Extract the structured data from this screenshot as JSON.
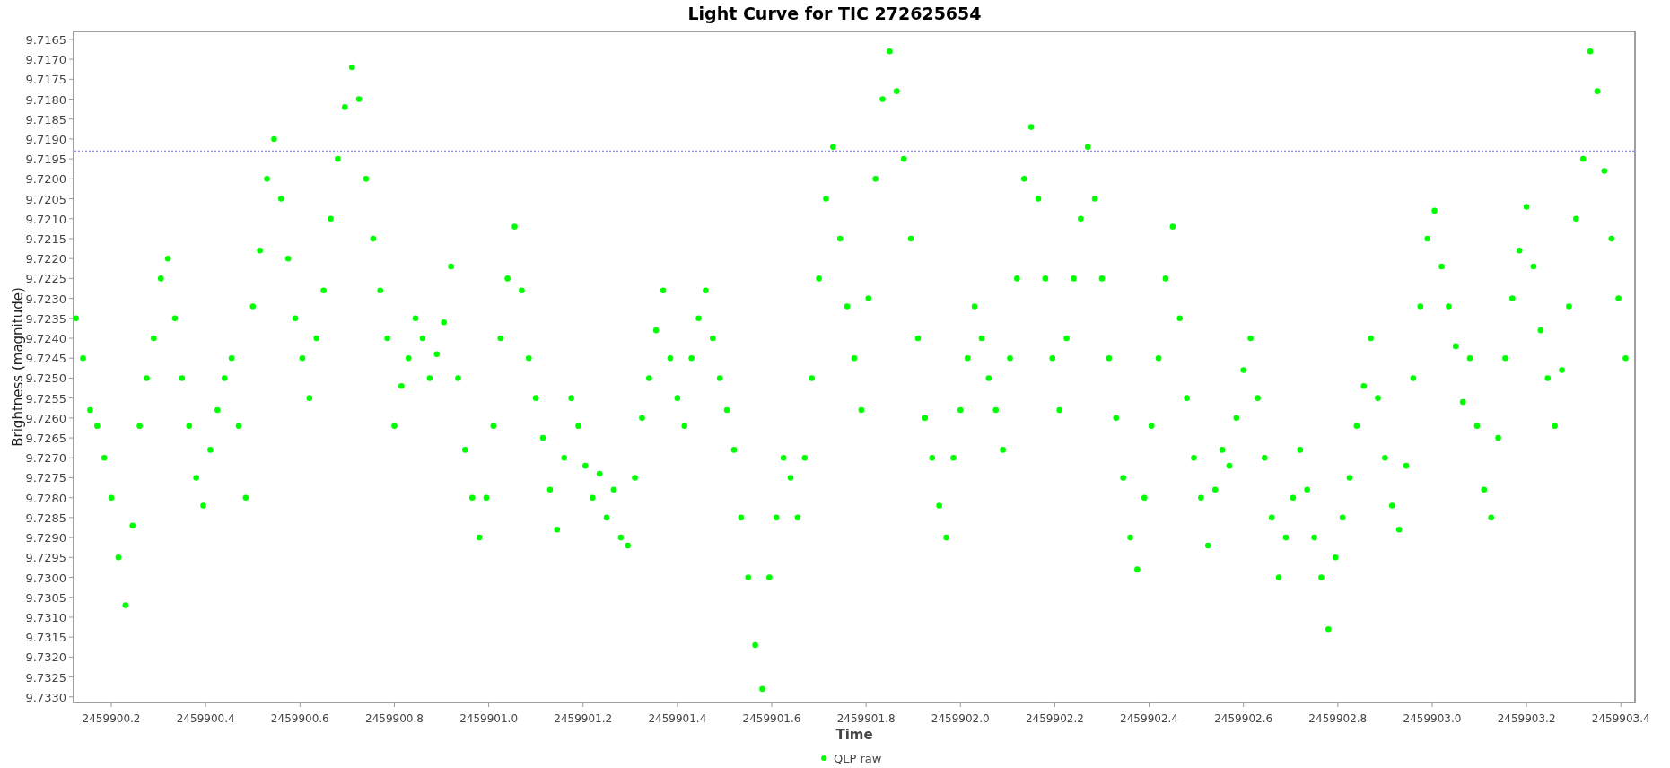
{
  "chart": {
    "chart_data": {
      "type": "scatter",
      "title": "Light Curve for TIC 272625654",
      "xlabel": "Time",
      "ylabel": "Brightness (magnitude)",
      "xlim": [
        2459900.12,
        2459903.43
      ],
      "ylim": [
        9.73314,
        9.7163
      ],
      "xticks": [
        {
          "value": 2459900.2,
          "label": "2459900.2"
        },
        {
          "value": 2459900.4,
          "label": "2459900.4"
        },
        {
          "value": 2459900.6,
          "label": "2459900.6"
        },
        {
          "value": 2459900.8,
          "label": "2459900.8"
        },
        {
          "value": 2459901.0,
          "label": "2459901.0"
        },
        {
          "value": 2459901.2,
          "label": "2459901.2"
        },
        {
          "value": 2459901.4,
          "label": "2459901.4"
        },
        {
          "value": 2459901.6,
          "label": "2459901.6"
        },
        {
          "value": 2459901.8,
          "label": "2459901.8"
        },
        {
          "value": 2459902.0,
          "label": "2459902.0"
        },
        {
          "value": 2459902.2,
          "label": "2459902.2"
        },
        {
          "value": 2459902.4,
          "label": "2459902.4"
        },
        {
          "value": 2459902.6,
          "label": "2459902.6"
        },
        {
          "value": 2459902.8,
          "label": "2459902.8"
        },
        {
          "value": 2459903.0,
          "label": "2459903.0"
        },
        {
          "value": 2459903.2,
          "label": "2459903.2"
        },
        {
          "value": 2459903.4,
          "label": "2459903.4"
        }
      ],
      "yticks": [
        {
          "value": 9.7165,
          "label": "9.7165"
        },
        {
          "value": 9.717,
          "label": "9.7170"
        },
        {
          "value": 9.7175,
          "label": "9.7175"
        },
        {
          "value": 9.718,
          "label": "9.7180"
        },
        {
          "value": 9.7185,
          "label": "9.7185"
        },
        {
          "value": 9.719,
          "label": "9.7190"
        },
        {
          "value": 9.7195,
          "label": "9.7195"
        },
        {
          "value": 9.72,
          "label": "9.7200"
        },
        {
          "value": 9.7205,
          "label": "9.7205"
        },
        {
          "value": 9.721,
          "label": "9.7210"
        },
        {
          "value": 9.7215,
          "label": "9.7215"
        },
        {
          "value": 9.722,
          "label": "9.7220"
        },
        {
          "value": 9.7225,
          "label": "9.7225"
        },
        {
          "value": 9.723,
          "label": "9.7230"
        },
        {
          "value": 9.7235,
          "label": "9.7235"
        },
        {
          "value": 9.724,
          "label": "9.7240"
        },
        {
          "value": 9.7245,
          "label": "9.7245"
        },
        {
          "value": 9.725,
          "label": "9.7250"
        },
        {
          "value": 9.7255,
          "label": "9.7255"
        },
        {
          "value": 9.726,
          "label": "9.7260"
        },
        {
          "value": 9.7265,
          "label": "9.7265"
        },
        {
          "value": 9.727,
          "label": "9.7270"
        },
        {
          "value": 9.7275,
          "label": "9.7275"
        },
        {
          "value": 9.728,
          "label": "9.7280"
        },
        {
          "value": 9.7285,
          "label": "9.7285"
        },
        {
          "value": 9.729,
          "label": "9.7290"
        },
        {
          "value": 9.7295,
          "label": "9.7295"
        },
        {
          "value": 9.73,
          "label": "9.7300"
        },
        {
          "value": 9.7305,
          "label": "9.7305"
        },
        {
          "value": 9.731,
          "label": "9.7310"
        },
        {
          "value": 9.7315,
          "label": "9.7315"
        },
        {
          "value": 9.732,
          "label": "9.7320"
        },
        {
          "value": 9.7325,
          "label": "9.7325"
        },
        {
          "value": 9.733,
          "label": "9.7330"
        }
      ],
      "ref_lines": [
        {
          "axis": "y",
          "value": 9.7193
        }
      ],
      "x": [
        2459900.125,
        2459900.14,
        2459900.155,
        2459900.17,
        2459900.185,
        2459900.2,
        2459900.215,
        2459900.23,
        2459900.245,
        2459900.26,
        2459900.275,
        2459900.29,
        2459900.305,
        2459900.32,
        2459900.335,
        2459900.35,
        2459900.365,
        2459900.38,
        2459900.395,
        2459900.41,
        2459900.425,
        2459900.44,
        2459900.455,
        2459900.47,
        2459900.485,
        2459900.5,
        2459900.515,
        2459900.53,
        2459900.545,
        2459900.56,
        2459900.575,
        2459900.59,
        2459900.605,
        2459900.62,
        2459900.635,
        2459900.65,
        2459900.665,
        2459900.68,
        2459900.695,
        2459900.71,
        2459900.725,
        2459900.74,
        2459900.755,
        2459900.77,
        2459900.785,
        2459900.8,
        2459900.815,
        2459900.83,
        2459900.845,
        2459900.86,
        2459900.875,
        2459900.89,
        2459900.905,
        2459900.92,
        2459900.935,
        2459900.95,
        2459900.965,
        2459900.98,
        2459900.995,
        2459901.01,
        2459901.025,
        2459901.04,
        2459901.055,
        2459901.07,
        2459901.085,
        2459901.1,
        2459901.115,
        2459901.13,
        2459901.145,
        2459901.16,
        2459901.175,
        2459901.19,
        2459901.205,
        2459901.22,
        2459901.235,
        2459901.25,
        2459901.265,
        2459901.28,
        2459901.295,
        2459901.31,
        2459901.325,
        2459901.34,
        2459901.355,
        2459901.37,
        2459901.385,
        2459901.4,
        2459901.415,
        2459901.43,
        2459901.445,
        2459901.46,
        2459901.475,
        2459901.49,
        2459901.505,
        2459901.52,
        2459901.535,
        2459901.55,
        2459901.565,
        2459901.58,
        2459901.595,
        2459901.61,
        2459901.625,
        2459901.64,
        2459901.655,
        2459901.67,
        2459901.685,
        2459901.7,
        2459901.715,
        2459901.73,
        2459901.745,
        2459901.76,
        2459901.775,
        2459901.79,
        2459901.805,
        2459901.82,
        2459901.835,
        2459901.85,
        2459901.865,
        2459901.88,
        2459901.895,
        2459901.91,
        2459901.925,
        2459901.94,
        2459901.955,
        2459901.97,
        2459901.985,
        2459902.0,
        2459902.015,
        2459902.03,
        2459902.045,
        2459902.06,
        2459902.075,
        2459902.09,
        2459902.105,
        2459902.12,
        2459902.135,
        2459902.15,
        2459902.165,
        2459902.18,
        2459902.195,
        2459902.21,
        2459902.225,
        2459902.24,
        2459902.255,
        2459902.27,
        2459902.285,
        2459902.3,
        2459902.315,
        2459902.33,
        2459902.345,
        2459902.36,
        2459902.375,
        2459902.39,
        2459902.405,
        2459902.42,
        2459902.435,
        2459902.45,
        2459902.465,
        2459902.48,
        2459902.495,
        2459902.51,
        2459902.525,
        2459902.54,
        2459902.555,
        2459902.57,
        2459902.585,
        2459902.6,
        2459902.615,
        2459902.63,
        2459902.645,
        2459902.66,
        2459902.675,
        2459902.69,
        2459902.705,
        2459902.72,
        2459902.735,
        2459902.75,
        2459902.765,
        2459902.78,
        2459902.795,
        2459902.81,
        2459902.825,
        2459902.84,
        2459902.855,
        2459902.87,
        2459902.885,
        2459902.9,
        2459902.915,
        2459902.93,
        2459902.945,
        2459902.96,
        2459902.975,
        2459902.99,
        2459903.005,
        2459903.02,
        2459903.035,
        2459903.05,
        2459903.065,
        2459903.08,
        2459903.095,
        2459903.11,
        2459903.125,
        2459903.14,
        2459903.155,
        2459903.17,
        2459903.185,
        2459903.2,
        2459903.215,
        2459903.23,
        2459903.245,
        2459903.26,
        2459903.275,
        2459903.29,
        2459903.305,
        2459903.32,
        2459903.335,
        2459903.35,
        2459903.365,
        2459903.38,
        2459903.395,
        2459903.41
      ],
      "series": [
        {
          "name": "QLP raw",
          "color": "#00ff00",
          "values": [
            9.7235,
            9.7245,
            9.7258,
            9.7262,
            9.727,
            9.728,
            9.7295,
            9.7307,
            9.7287,
            9.7262,
            9.725,
            9.724,
            9.7225,
            9.722,
            9.7235,
            9.725,
            9.7262,
            9.7275,
            9.7282,
            9.7268,
            9.7258,
            9.725,
            9.7245,
            9.7262,
            9.728,
            9.7232,
            9.7218,
            9.72,
            9.719,
            9.7205,
            9.722,
            9.7235,
            9.7245,
            9.7255,
            9.724,
            9.7228,
            9.721,
            9.7195,
            9.7182,
            9.7172,
            9.718,
            9.72,
            9.7215,
            9.7228,
            9.724,
            9.7262,
            9.7252,
            9.7245,
            9.7235,
            9.724,
            9.725,
            9.7244,
            9.7236,
            9.7222,
            9.725,
            9.7268,
            9.728,
            9.729,
            9.728,
            9.7262,
            9.724,
            9.7225,
            9.7212,
            9.7228,
            9.7245,
            9.7255,
            9.7265,
            9.7278,
            9.7288,
            9.727,
            9.7255,
            9.7262,
            9.7272,
            9.728,
            9.7274,
            9.7285,
            9.7278,
            9.729,
            9.7292,
            9.7275,
            9.726,
            9.725,
            9.7238,
            9.7228,
            9.7245,
            9.7255,
            9.7262,
            9.7245,
            9.7235,
            9.7228,
            9.724,
            9.725,
            9.7258,
            9.7268,
            9.7285,
            9.73,
            9.7317,
            9.7328,
            9.73,
            9.7285,
            9.727,
            9.7275,
            9.7285,
            9.727,
            9.725,
            9.7225,
            9.7205,
            9.7192,
            9.7215,
            9.7232,
            9.7245,
            9.7258,
            9.723,
            9.72,
            9.718,
            9.7168,
            9.7178,
            9.7195,
            9.7215,
            9.724,
            9.726,
            9.727,
            9.7282,
            9.729,
            9.727,
            9.7258,
            9.7245,
            9.7232,
            9.724,
            9.725,
            9.7258,
            9.7268,
            9.7245,
            9.7225,
            9.72,
            9.7187,
            9.7205,
            9.7225,
            9.7245,
            9.7258,
            9.724,
            9.7225,
            9.721,
            9.7192,
            9.7205,
            9.7225,
            9.7245,
            9.726,
            9.7275,
            9.729,
            9.7298,
            9.728,
            9.7262,
            9.7245,
            9.7225,
            9.7212,
            9.7235,
            9.7255,
            9.727,
            9.728,
            9.7292,
            9.7278,
            9.7268,
            9.7272,
            9.726,
            9.7248,
            9.724,
            9.7255,
            9.727,
            9.7285,
            9.73,
            9.729,
            9.728,
            9.7268,
            9.7278,
            9.729,
            9.73,
            9.7313,
            9.7295,
            9.7285,
            9.7275,
            9.7262,
            9.7252,
            9.724,
            9.7255,
            9.727,
            9.7282,
            9.7288,
            9.7272,
            9.725,
            9.7232,
            9.7215,
            9.7208,
            9.7222,
            9.7232,
            9.7242,
            9.7256,
            9.7245,
            9.7262,
            9.7278,
            9.7285,
            9.7265,
            9.7245,
            9.723,
            9.7218,
            9.7207,
            9.7222,
            9.7238,
            9.725,
            9.7262,
            9.7248,
            9.7232,
            9.721,
            9.7195,
            9.7168,
            9.7178,
            9.7198,
            9.7215,
            9.723,
            9.7245
          ]
        }
      ]
    }
  }
}
